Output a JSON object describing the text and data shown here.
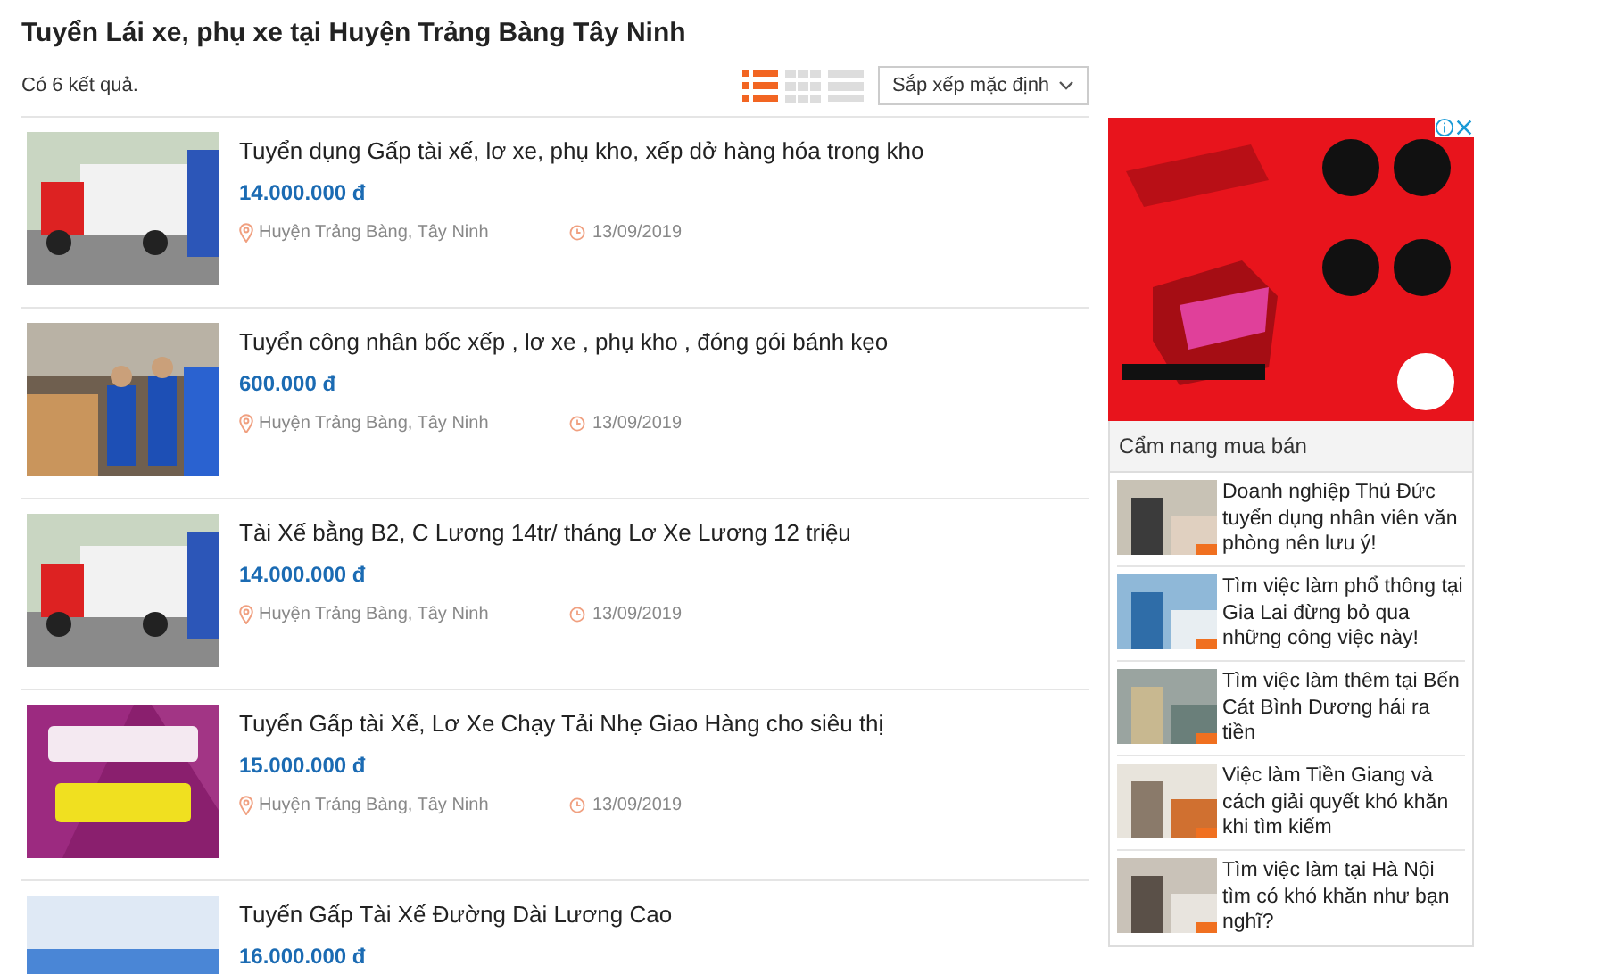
{
  "heading": "Tuyển Lái xe, phụ xe tại Huyện Trảng Bàng Tây Ninh",
  "result_count": "Có 6 kết quả.",
  "views": [
    {
      "kind": "list",
      "selected": true
    },
    {
      "kind": "grid",
      "selected": false
    },
    {
      "kind": "rows",
      "selected": false
    }
  ],
  "sort": {
    "value": "Sắp xếp mặc định"
  },
  "listings": [
    {
      "title": "Tuyển dụng Gấp tài xế, lơ xe, phụ kho, xếp dở hàng hóa trong kho",
      "price": "14.000.000 đ",
      "location": "Huyện Trảng Bàng, Tây Ninh",
      "date": "13/09/2019"
    },
    {
      "title": "Tuyển công nhân bốc xếp , lơ xe , phụ kho , đóng gói bánh kẹo",
      "price": "600.000 đ",
      "location": "Huyện Trảng Bàng, Tây Ninh",
      "date": "13/09/2019"
    },
    {
      "title": "Tài Xế bằng B2, C Lương 14tr/ tháng Lơ Xe Lương 12 triệu",
      "price": "14.000.000 đ",
      "location": "Huyện Trảng Bàng, Tây Ninh",
      "date": "13/09/2019"
    },
    {
      "title": "Tuyển Gấp tài Xế, Lơ Xe Chạy Tải Nhẹ Giao Hàng cho siêu thị",
      "price": "15.000.000 đ",
      "location": "Huyện Trảng Bàng, Tây Ninh",
      "date": "13/09/2019"
    },
    {
      "title": "Tuyển Gấp Tài Xế Đường Dài Lương Cao",
      "price": "16.000.000 đ"
    }
  ],
  "guide": {
    "title": "Cẩm nang mua bán",
    "articles": [
      {
        "title": "Doanh nghiệp Thủ Đức tuyển dụng nhân viên văn phòng nên lưu ý!"
      },
      {
        "title": "Tìm việc làm phổ thông tại Gia Lai đừng bỏ qua những công việc này!"
      },
      {
        "title": "Tìm việc làm thêm tại Bến Cát Bình Dương hái ra tiền"
      },
      {
        "title": "Việc làm Tiền Giang và cách giải quyết khó khăn khi tìm kiếm"
      },
      {
        "title": "Tìm việc làm tại Hà Nội tìm có khó khăn như bạn nghĩ?"
      }
    ]
  }
}
